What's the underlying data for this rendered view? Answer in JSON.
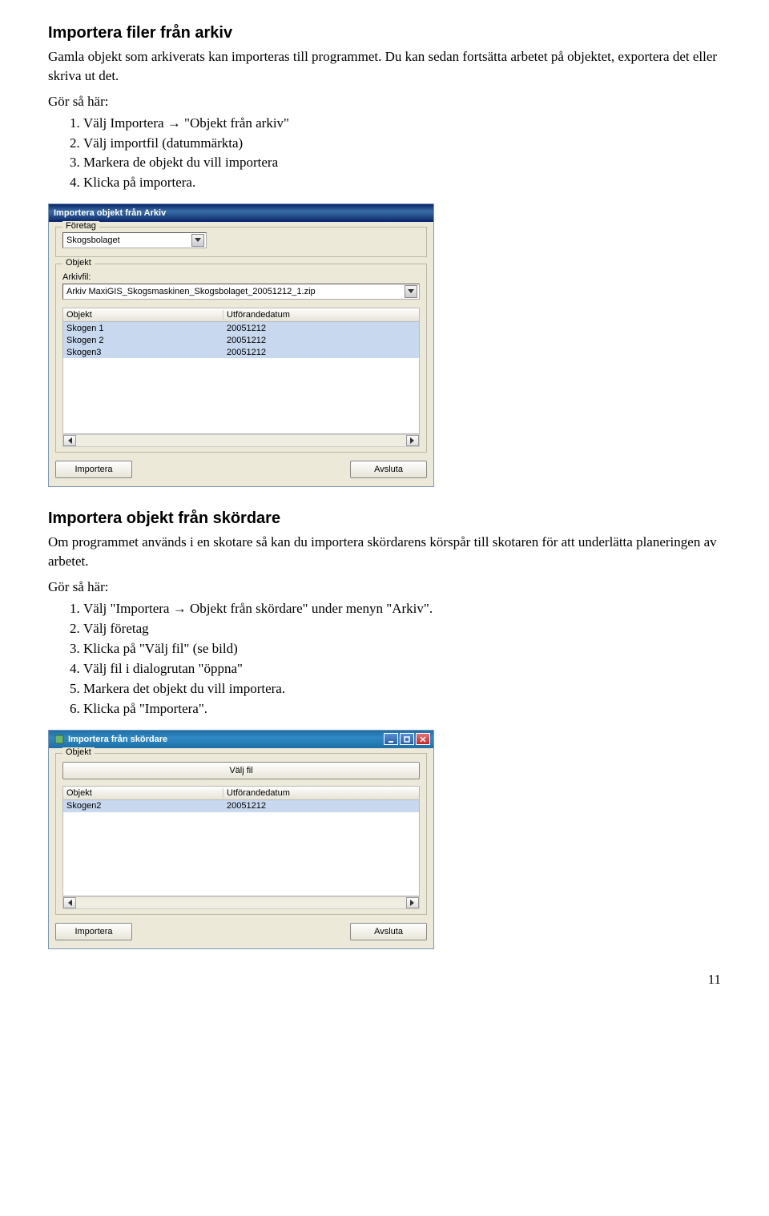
{
  "sections": {
    "archive": {
      "heading": "Importera filer från arkiv",
      "intro": "Gamla objekt som arkiverats kan importeras till programmet. Du kan sedan fortsätta arbetet på objektet, exportera det eller skriva ut det.",
      "howto_label": "Gör så här:",
      "steps": [
        "Välj Importera → \"Objekt från arkiv\"",
        "Välj importfil (datummärkta)",
        "Markera de objekt du vill importera",
        "Klicka på importera."
      ]
    },
    "dialog1": {
      "title": "Importera objekt från Arkiv",
      "legend_company": "Företag",
      "company": "Skogsbolaget",
      "legend_object": "Objekt",
      "label_arkivfil": "Arkivfil:",
      "arkivfil": "Arkiv MaxiGIS_Skogsmaskinen_Skogsbolaget_20051212_1.zip",
      "col1": "Objekt",
      "col2": "Utförandedatum",
      "rows": [
        {
          "name": "Skogen 1",
          "date": "20051212"
        },
        {
          "name": "Skogen 2",
          "date": "20051212"
        },
        {
          "name": "Skogen3",
          "date": "20051212"
        }
      ],
      "btn_import": "Importera",
      "btn_close": "Avsluta"
    },
    "harvester": {
      "heading": "Importera objekt från skördare",
      "intro": "Om programmet används i en skotare så kan du importera skördarens körspår till skotaren för att underlätta planeringen av arbetet.",
      "howto_label": "Gör så här:",
      "steps": [
        "Välj \"Importera → Objekt från skördare\" under menyn \"Arkiv\".",
        "Välj företag",
        "Klicka på \"Välj fil\" (se bild)",
        "Välj fil i dialogrutan \"öppna\"",
        "Markera det objekt du vill importera.",
        "Klicka på \"Importera\"."
      ]
    },
    "dialog2": {
      "title": "Importera från skördare",
      "legend_object": "Objekt",
      "btn_choose": "Välj fil",
      "col1": "Objekt",
      "col2": "Utförandedatum",
      "rows": [
        {
          "name": "Skogen2",
          "date": "20051212"
        }
      ],
      "btn_import": "Importera",
      "btn_close": "Avsluta"
    }
  },
  "page_number": "11"
}
